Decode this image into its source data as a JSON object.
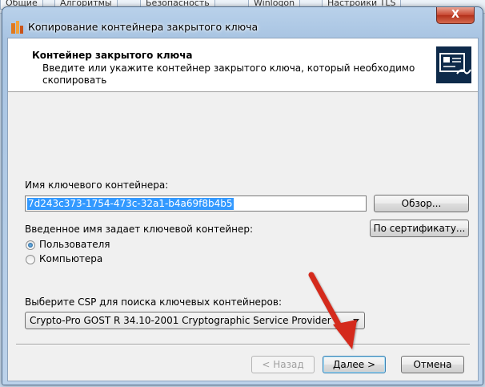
{
  "background_window": {
    "tabs": [
      "Общие",
      "Алгоритмы",
      "Безопасность",
      "Winlogon",
      "Настройки TLS"
    ]
  },
  "window": {
    "title": "Копирование контейнера закрытого ключа",
    "close_label": "X"
  },
  "header": {
    "title": "Контейнер закрытого ключа",
    "description": "Введите или укажите контейнер закрытого ключа, который необходимо скопировать",
    "icon": "key-certificate-icon"
  },
  "form": {
    "container_label": "Имя ключевого контейнера:",
    "container_value": "7d243c373-1754-473c-32a1-b4a69f8b4b5",
    "browse_button": "Обзор...",
    "name_type_label": "Введенное имя задает ключевой контейнер:",
    "by_certificate_button": "По сертификату...",
    "radio_user": "Пользователя",
    "radio_computer": "Компьютера",
    "radio_selected": "user",
    "csp_label": "Выберите CSP для поиска ключевых контейнеров:",
    "csp_value": "Crypto-Pro GOST R 34.10-2001 Cryptographic Service Provider"
  },
  "footer": {
    "back_button": "< Назад",
    "next_button": "Далее >",
    "cancel_button": "Отмена"
  },
  "annotation": {
    "arrow_color": "#d42a1e",
    "arrow_target": "next-button"
  },
  "colors": {
    "selection": "#3399ff",
    "title_bar": "#b9d1ea",
    "close_button": "#c7462f"
  }
}
